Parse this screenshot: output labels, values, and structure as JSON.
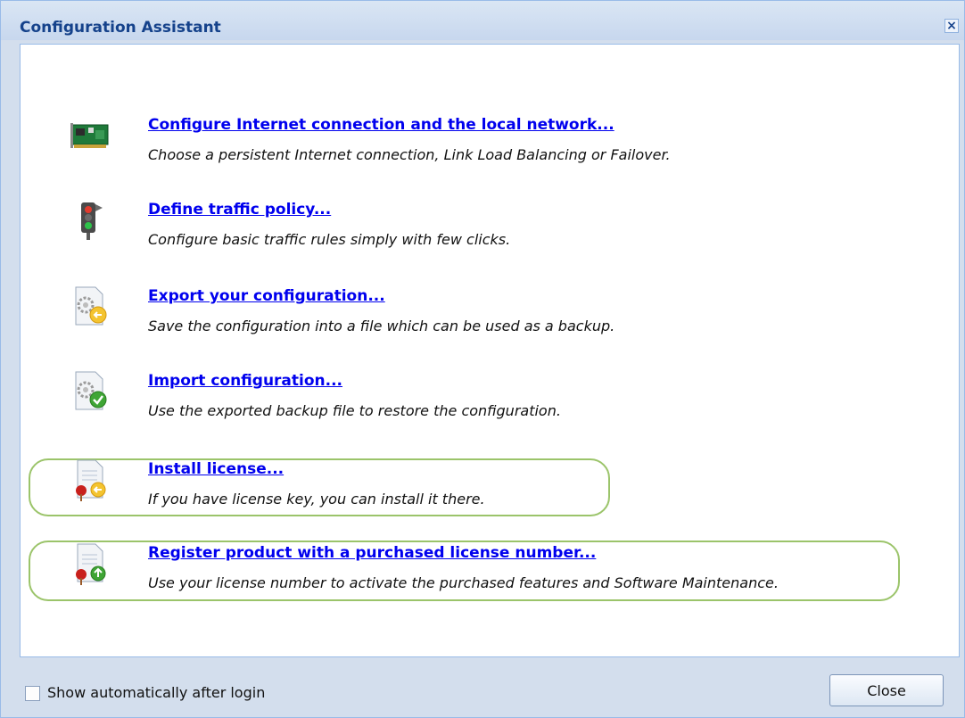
{
  "window": {
    "title": "Configuration Assistant",
    "close_glyph": "×"
  },
  "items": [
    {
      "label": "Configure Internet connection and the local network...",
      "description": "Choose a persistent Internet connection, Link Load Balancing or Failover.",
      "icon": "network-card-icon"
    },
    {
      "label": "Define traffic policy...",
      "description": "Configure basic traffic rules simply with few clicks.",
      "icon": "traffic-light-icon"
    },
    {
      "label": "Export your configuration...",
      "description": "Save the configuration into a file which can be used as a backup.",
      "icon": "config-export-icon"
    },
    {
      "label": "Import configuration...",
      "description": "Use the exported backup file to restore the configuration.",
      "icon": "config-import-icon"
    },
    {
      "label": "Install license...",
      "description": "If you have license key, you can install it there.",
      "icon": "license-install-icon",
      "highlighted": true
    },
    {
      "label": "Register product with a purchased license number...",
      "description": "Use your license number to activate the purchased features and Software Maintenance.",
      "icon": "license-register-icon",
      "highlighted": true
    }
  ],
  "footer": {
    "show_automatically_label": "Show automatically after login",
    "show_automatically_checked": false,
    "close_button": "Close"
  },
  "colors": {
    "link": "#0000ee",
    "title": "#15428b",
    "highlight": "#9bc46a"
  }
}
